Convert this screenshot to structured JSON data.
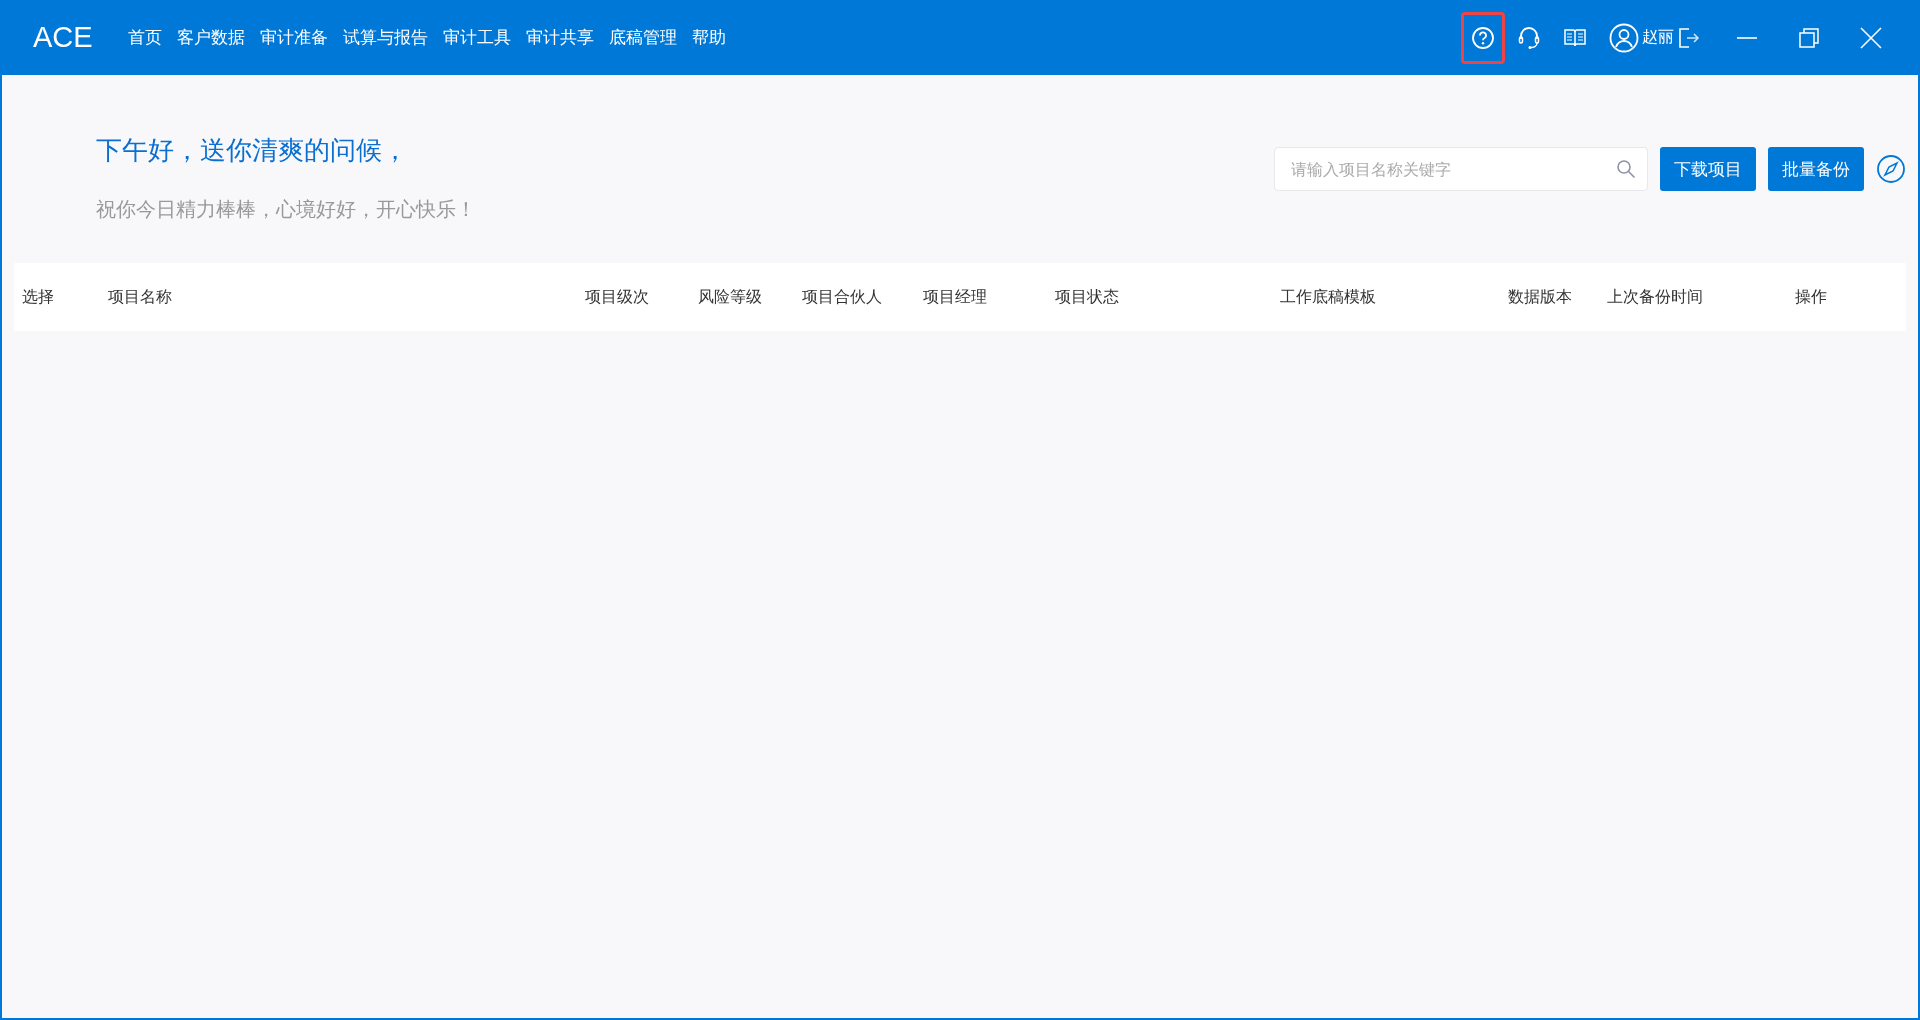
{
  "app": {
    "logo": "ACE"
  },
  "nav": [
    {
      "label": "首页"
    },
    {
      "label": "客户数据"
    },
    {
      "label": "审计准备"
    },
    {
      "label": "试算与报告"
    },
    {
      "label": "审计工具"
    },
    {
      "label": "审计共享"
    },
    {
      "label": "底稿管理"
    },
    {
      "label": "帮助"
    }
  ],
  "toolbar": [
    {
      "kind": "help",
      "highlighted": true
    },
    {
      "kind": "headset",
      "highlighted": false
    },
    {
      "kind": "book",
      "highlighted": false
    }
  ],
  "user": {
    "name": "赵丽"
  },
  "greeting": {
    "title": "下午好，送你清爽的问候，",
    "subtitle": "祝你今日精力棒棒，心境好好，开心快乐！"
  },
  "search": {
    "placeholder": "请输入项目名称关键字"
  },
  "buttons": [
    {
      "label": "下载项目"
    },
    {
      "label": "批量备份"
    }
  ],
  "table": {
    "columns": [
      "选择",
      "项目名称",
      "项目级次",
      "风险等级",
      "项目合伙人",
      "项目经理",
      "项目状态",
      "工作底稿模板",
      "数据版本",
      "上次备份时间",
      "操作"
    ]
  }
}
